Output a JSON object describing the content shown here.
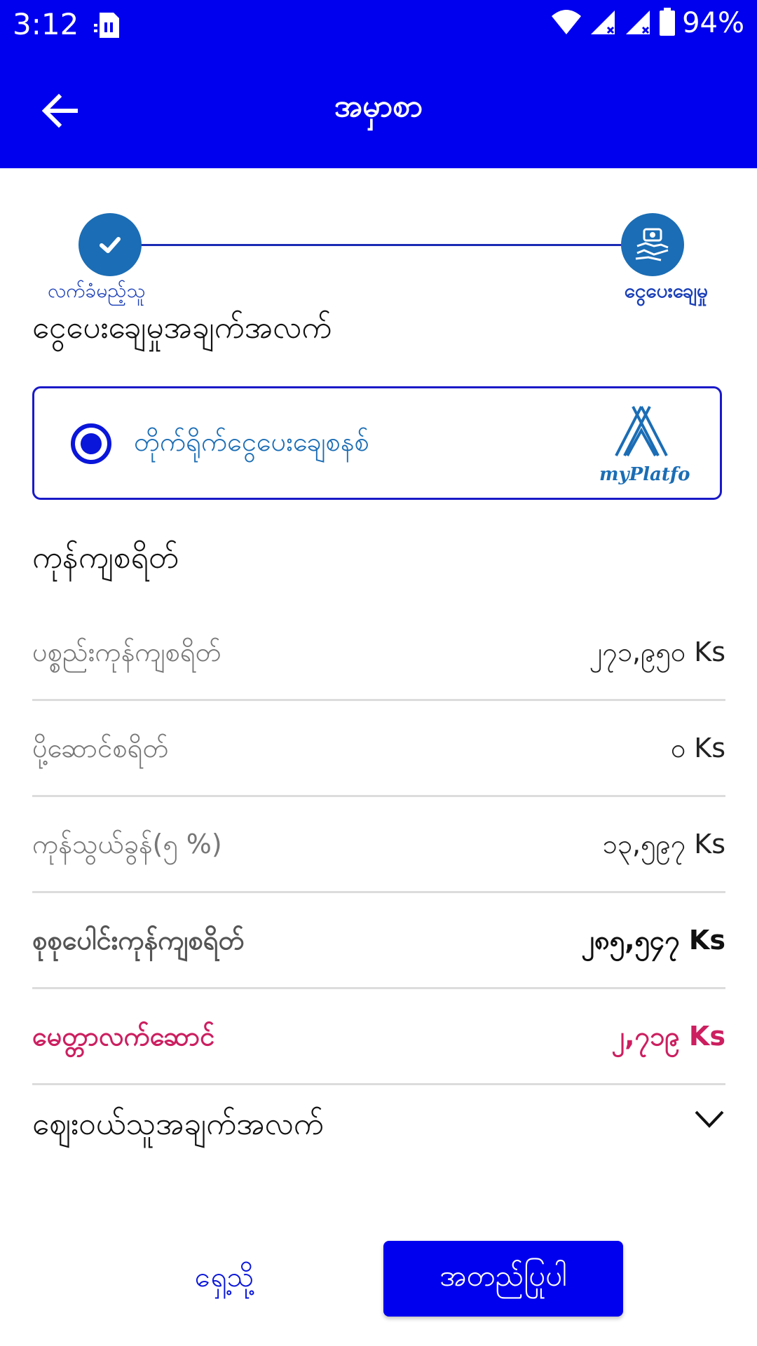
{
  "status_bar": {
    "time": "3:12",
    "battery": "94%"
  },
  "header": {
    "title": "အမှာစာ"
  },
  "stepper": {
    "steps": [
      {
        "label": "လက်ခံမည့်သူ",
        "state": "done"
      },
      {
        "label": "ငွေပေးချေမှု",
        "state": "current"
      }
    ]
  },
  "payment": {
    "section_title": "ငွေပေးချေမှုအချက်အလက်",
    "method_label": "တိုက်ရိုက်ငွေပေးချေစနစ်",
    "method_selected": true,
    "brand_name": "myPlatfo"
  },
  "prices": {
    "section_title": "ကုန်ကျစရိတ်",
    "rows": [
      {
        "label": "ပစ္စည်းကုန်ကျစရိတ်",
        "value": "၂၇၁,၉၅၀",
        "unit": "Ks"
      },
      {
        "label": "ပို့ဆောင်စရိတ်",
        "value": "၀",
        "unit": "Ks"
      },
      {
        "label": "ကုန်သွယ်ခွန်(၅ %)",
        "value": "၁၃,၅၉၇",
        "unit": "Ks"
      },
      {
        "label": "စုစုပေါင်းကုန်ကျစရိတ်",
        "value": "၂၈၅,၅၄၇",
        "unit": "Ks"
      },
      {
        "label": "မေတ္တာလက်ဆောင်",
        "value": "၂,၇၁၉",
        "unit": "Ks"
      }
    ]
  },
  "buyer": {
    "section_title": "ဈေးဝယ်သူအချက်အလက်"
  },
  "actions": {
    "back_label": "ရှေ့သို့",
    "confirm_label": "အတည်ပြုပါ"
  },
  "colors": {
    "primary": "#0000ef",
    "accent": "#1b6db5",
    "member": "#cc1f60"
  }
}
